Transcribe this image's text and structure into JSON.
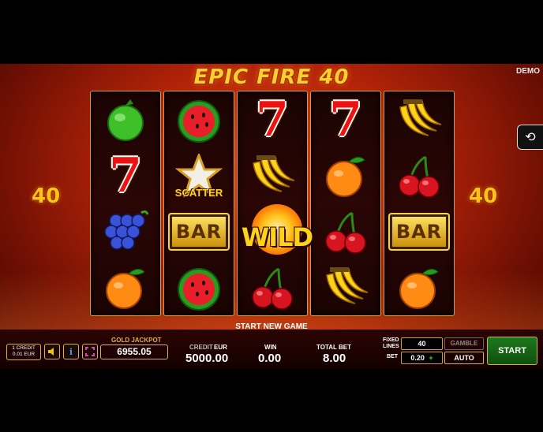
{
  "header": {
    "title": "EPIC FIRE 40",
    "demo_label": "DEMO",
    "lines_left": "40",
    "lines_right": "40"
  },
  "reels": [
    [
      "lime",
      "seven",
      "grapes",
      "orange"
    ],
    [
      "watermelon",
      "scatter",
      "bar",
      "watermelon"
    ],
    [
      "seven",
      "banana",
      "wild",
      "cherry"
    ],
    [
      "seven",
      "orange",
      "cherry",
      "banana"
    ],
    [
      "banana",
      "cherry",
      "bar",
      "orange"
    ]
  ],
  "symbols": {
    "seven": "7",
    "bar": "BAR",
    "wild": "WILD",
    "scatter": "SCATTER"
  },
  "status": {
    "message": "START NEW GAME"
  },
  "controls": {
    "credit_line1": "1 CREDIT",
    "credit_line2": "0.01 EUR",
    "gold_jackpot_label": "GOLD JACKPOT",
    "gold_jackpot_value": "6955.05",
    "credit_label": "CREDIT",
    "credit_currency": "EUR",
    "credit_value": "5000.00",
    "win_label": "WIN",
    "win_value": "0.00",
    "total_bet_label": "TOTAL BET",
    "total_bet_value": "8.00",
    "fixed_lines_label_1": "FIXED",
    "fixed_lines_label_2": "LINES",
    "fixed_lines_value": "40",
    "bet_label": "BET",
    "bet_value": "0.20",
    "bet_plus": "+",
    "gamble_label": "GAMBLE",
    "auto_label": "AUTO",
    "start_label": "START"
  },
  "colors": {
    "gold": "#d8b04a",
    "start_green": "#1c7a1c",
    "background_red": "#b02208"
  }
}
